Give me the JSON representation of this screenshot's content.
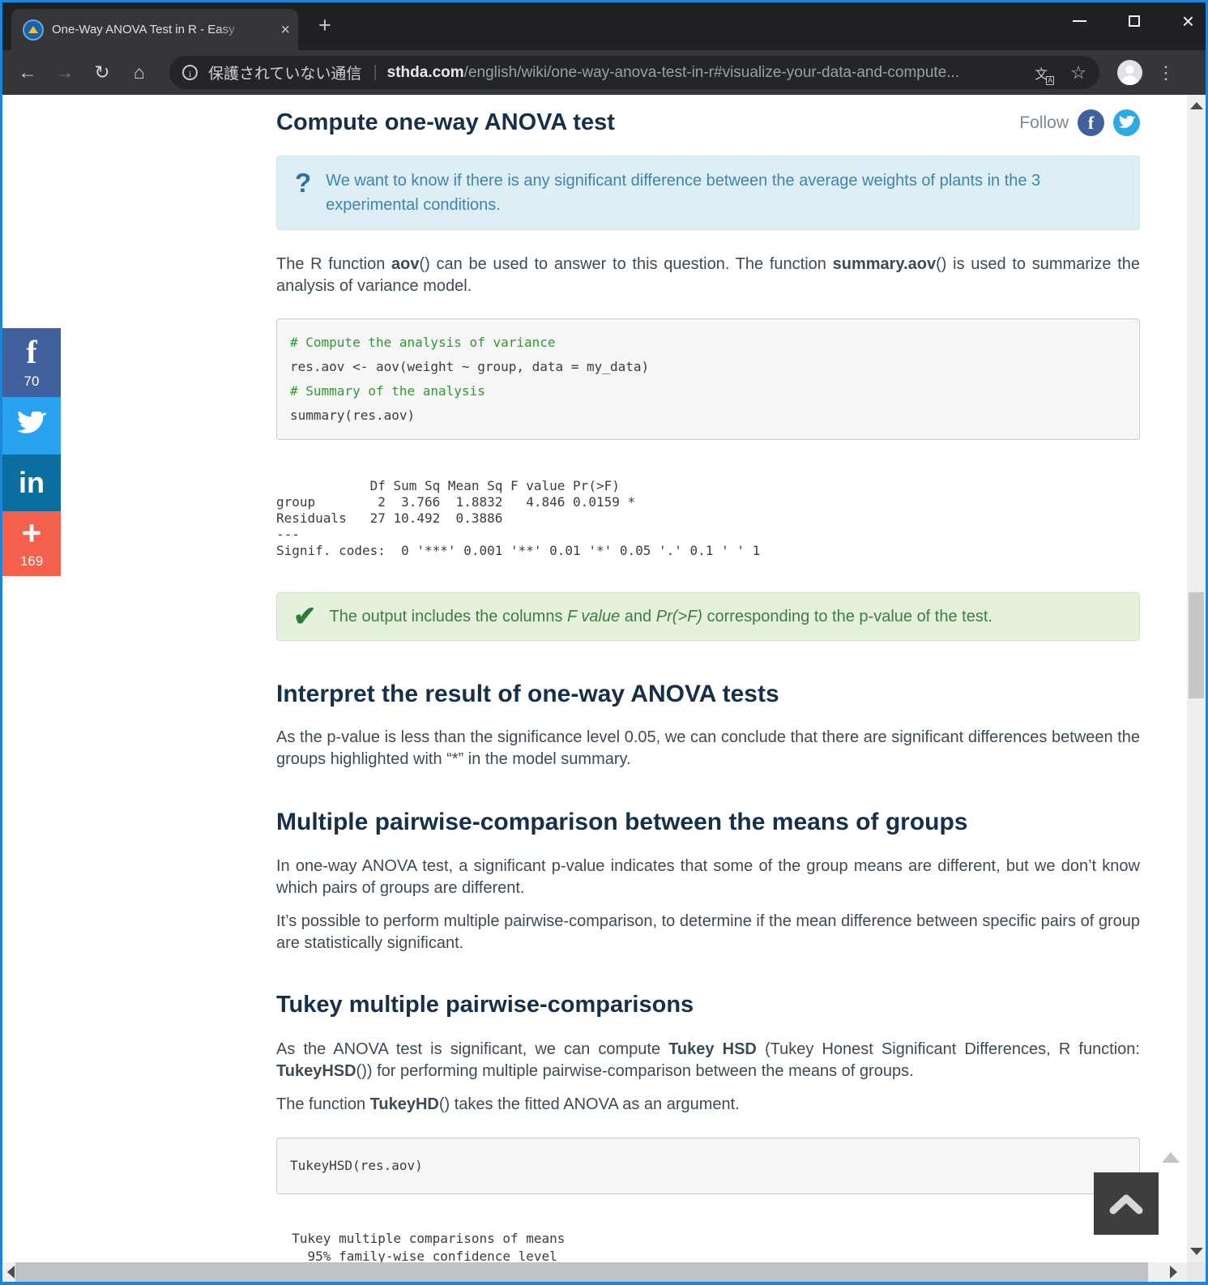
{
  "browser": {
    "tab": {
      "title": "One-Way ANOVA Test in R - Easy",
      "close_glyph": "×",
      "new_tab_glyph": "+"
    },
    "nav": {
      "back_glyph": "←",
      "forward_glyph": "→",
      "reload_glyph": "↻",
      "home_glyph": "⌂"
    },
    "omnibox": {
      "info_glyph": "i",
      "security_text": "保護されていない通信",
      "separator": "|",
      "url_host": "sthda.com",
      "url_path": "/english/wiki/one-way-anova-test-in-r#visualize-your-data-and-compute...",
      "translate_glyph": "文",
      "star_glyph": "☆"
    },
    "menu_glyph": "⋮",
    "window_controls": {
      "close_glyph": "×"
    }
  },
  "social_sidebar": {
    "facebook": {
      "glyph": "f",
      "count": "70",
      "color": "#41609c"
    },
    "twitter": {
      "color": "#29a3ef"
    },
    "linkedin": {
      "glyph": "in",
      "color": "#0c6e9e"
    },
    "share": {
      "glyph": "+",
      "count": "169",
      "color": "#f4604e"
    }
  },
  "article": {
    "heading1": "Compute one-way ANOVA test",
    "follow_label": "Follow",
    "fb_glyph": "f",
    "info_box": {
      "icon": "?",
      "text": "We want to know if there is any significant difference between the average weights of plants in the 3 experimental conditions."
    },
    "para_aov": {
      "t1": "The R function ",
      "b1": "aov",
      "t2": "() can be used to answer to this question. The function ",
      "b2": "summary.aov",
      "t3": "() is used to summarize the analysis of variance model."
    },
    "code1": {
      "line1": "# Compute the analysis of variance",
      "line2": "res.aov <- aov(weight ~ group, data = my_data)",
      "line3": "# Summary of the analysis",
      "line4": "summary(res.aov)"
    },
    "anova_output": "            Df Sum Sq Mean Sq F value Pr(>F)  \ngroup        2  3.766  1.8832   4.846 0.0159 *\nResiduals   27 10.492  0.3886                 \n---\nSignif. codes:  0 '***' 0.001 '**' 0.01 '*' 0.05 '.' 0.1 ' ' 1",
    "success_box": {
      "check_glyph": "✔",
      "t1": "The output includes the columns ",
      "i1": "F value",
      "t2": " and ",
      "i2": "Pr(>F)",
      "t3": " corresponding to the p-value of the test."
    },
    "heading2": "Interpret the result of one-way ANOVA tests",
    "para_interpret": "As the p-value is less than the significance level 0.05, we can conclude that there are significant differences between the groups highlighted with “*” in the model summary.",
    "heading3": "Multiple pairwise-comparison between the means of groups",
    "para_pairwise1": "In one-way ANOVA test, a significant p-value indicates that some of the group means are different, but we don’t know which pairs of groups are different.",
    "para_pairwise2": "It’s possible to perform multiple pairwise-comparison, to determine if the mean difference between specific pairs of group are statistically significant.",
    "heading4": "Tukey multiple pairwise-comparisons",
    "para_tukey1": {
      "t1": "As the ANOVA test is significant, we can compute ",
      "b1": "Tukey HSD",
      "t2": " (Tukey Honest Significant Differences, R function: ",
      "b2": "TukeyHSD",
      "t3": "()) for performing multiple pairwise-comparison between the means of groups."
    },
    "para_tukey2": {
      "t1": "The function ",
      "b1": "TukeyHD",
      "t2": "() takes the fitted ANOVA as an argument."
    },
    "code2": {
      "line1": "TukeyHSD(res.aov)"
    },
    "tukey_output": "  Tukey multiple comparisons of means\n    95% family-wise confidence level"
  }
}
